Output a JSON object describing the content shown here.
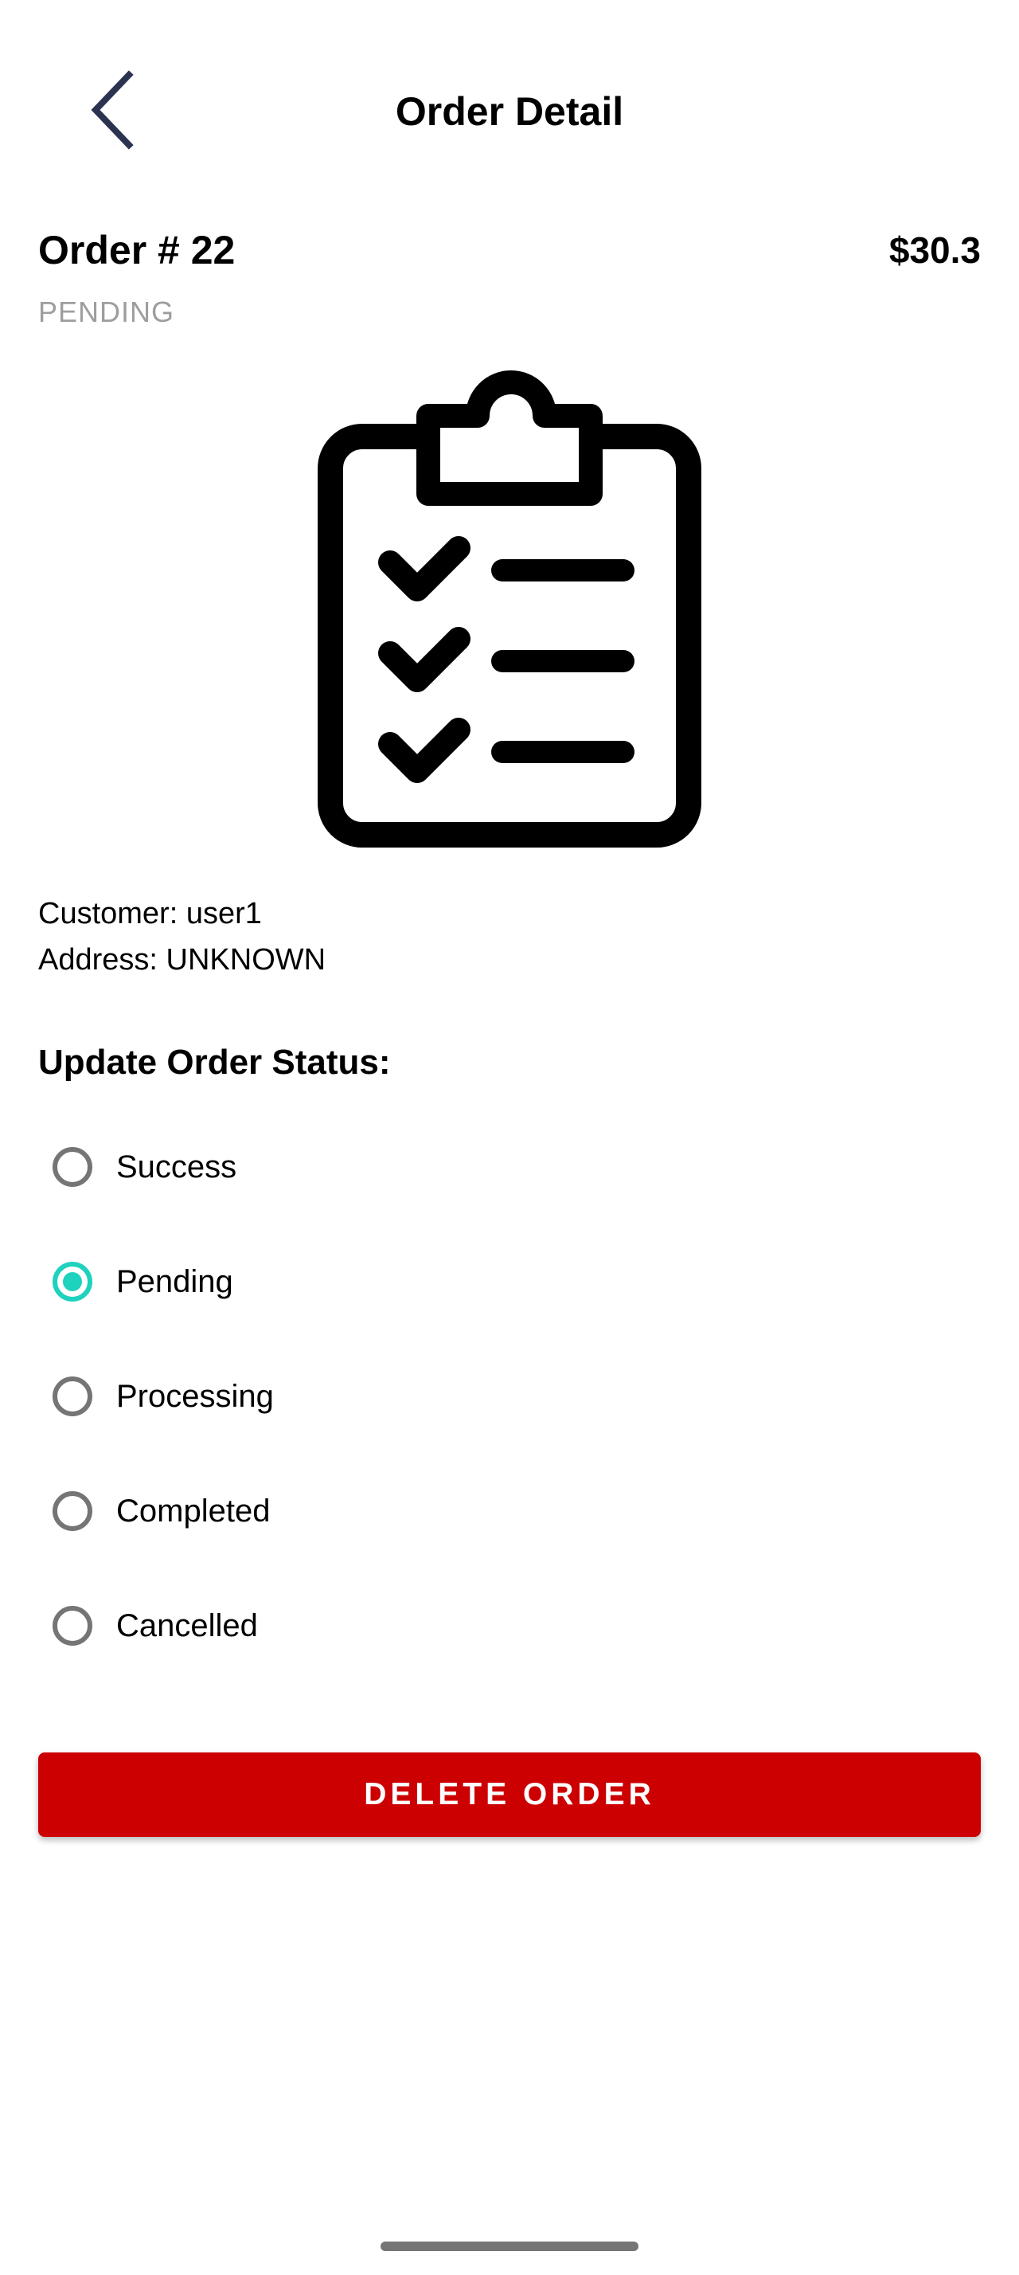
{
  "header": {
    "title": "Order Detail",
    "back_icon": "chevron-left-icon",
    "back_color": "#2b3350"
  },
  "order": {
    "number_label": "Order # 22",
    "total": "$30.3",
    "status": "PENDING",
    "image_icon": "clipboard-checklist-icon",
    "customer": "Customer: user1",
    "address": "Address: UNKNOWN"
  },
  "status_update": {
    "title": "Update Order Status:",
    "options": [
      {
        "label": "Success",
        "selected": false
      },
      {
        "label": "Pending",
        "selected": true
      },
      {
        "label": "Processing",
        "selected": false
      },
      {
        "label": "Completed",
        "selected": false
      },
      {
        "label": "Cancelled",
        "selected": false
      }
    ],
    "selected_color": "#1ed2bd"
  },
  "actions": {
    "delete_label": "DELETE ORDER",
    "delete_color": "#cc0000"
  }
}
